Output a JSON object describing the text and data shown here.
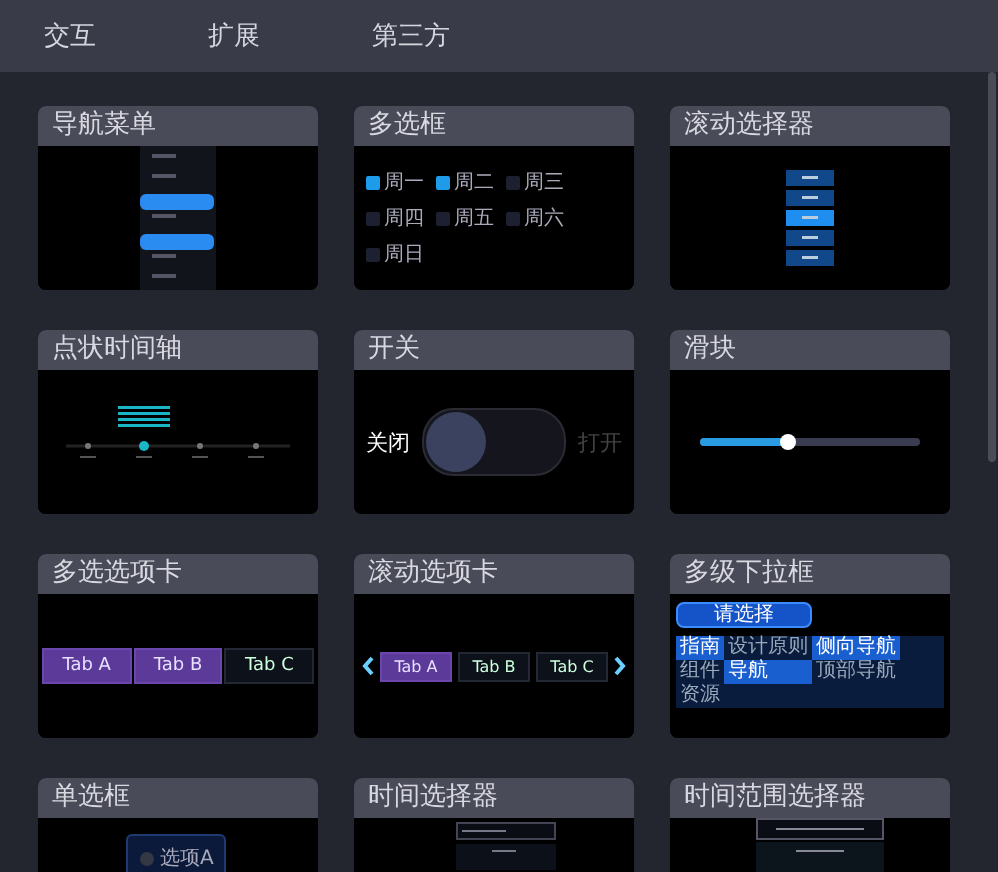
{
  "nav_tabs": [
    {
      "label": "交互"
    },
    {
      "label": "扩展"
    },
    {
      "label": "第三方"
    }
  ],
  "cards": [
    {
      "title": "导航菜单",
      "kind": "nav_menu"
    },
    {
      "title": "多选框",
      "kind": "checkbox",
      "items": [
        {
          "label": "周一",
          "checked": true
        },
        {
          "label": "周二",
          "checked": true
        },
        {
          "label": "周三",
          "checked": false
        },
        {
          "label": "周四",
          "checked": false
        },
        {
          "label": "周五",
          "checked": false
        },
        {
          "label": "周六",
          "checked": false
        },
        {
          "label": "周日",
          "checked": false
        }
      ]
    },
    {
      "title": "滚动选择器",
      "kind": "scroll_picker"
    },
    {
      "title": "点状时间轴",
      "kind": "timeline"
    },
    {
      "title": "开关",
      "kind": "switch",
      "off_label": "关闭",
      "on_label": "打开",
      "on": false
    },
    {
      "title": "滑块",
      "kind": "slider",
      "level": 0.4
    },
    {
      "title": "多选选项卡",
      "kind": "tabs",
      "tabs": [
        {
          "label": "Tab A",
          "selected": true
        },
        {
          "label": "Tab B",
          "selected": true
        },
        {
          "label": "Tab C",
          "selected": false
        }
      ]
    },
    {
      "title": "滚动选项卡",
      "kind": "scroll_tabs",
      "tabs": [
        {
          "label": "Tab A",
          "selected": true
        },
        {
          "label": "Tab B",
          "selected": false
        },
        {
          "label": "Tab C",
          "selected": false
        }
      ]
    },
    {
      "title": "多级下拉框",
      "kind": "cascader",
      "placeholder": "请选择",
      "columns": [
        [
          {
            "label": "指南",
            "selected": true
          },
          {
            "label": "组件",
            "selected": false
          },
          {
            "label": "资源",
            "selected": false
          }
        ],
        [
          {
            "label": "设计原则",
            "selected": false
          },
          {
            "label": "导航",
            "selected": true
          }
        ],
        [
          {
            "label": "侧向导航",
            "selected": true
          },
          {
            "label": "顶部导航",
            "selected": false
          }
        ]
      ]
    },
    {
      "title": "单选框",
      "kind": "radio",
      "option": {
        "label": "选项A",
        "selected": false
      }
    },
    {
      "title": "时间选择器",
      "kind": "time_picker"
    },
    {
      "title": "时间范围选择器",
      "kind": "range_picker"
    }
  ]
}
